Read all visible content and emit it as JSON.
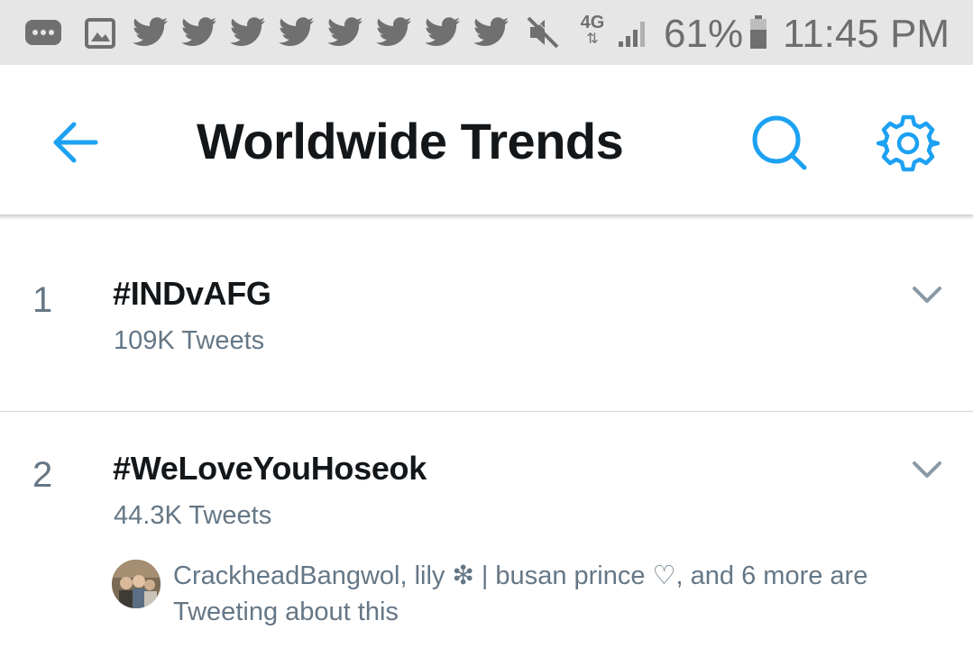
{
  "status_bar": {
    "network": "4G",
    "battery": "61%",
    "time": "11:45 PM",
    "icons": [
      "messages-icon",
      "gallery-icon",
      "twitter-icon",
      "twitter-icon",
      "twitter-icon",
      "twitter-icon",
      "twitter-icon",
      "twitter-icon",
      "twitter-icon",
      "twitter-icon",
      "mute-icon",
      "network-4g-icon",
      "signal-icon",
      "battery-icon"
    ]
  },
  "toolbar": {
    "title": "Worldwide Trends",
    "back_icon": "arrow-left-icon",
    "search_icon": "search-icon",
    "settings_icon": "gear-icon"
  },
  "trends": [
    {
      "rank": "1",
      "name": "#INDvAFG",
      "count": "109K Tweets"
    },
    {
      "rank": "2",
      "name": "#WeLoveYouHoseok",
      "count": "44.3K Tweets",
      "context": "CrackheadBangwol, lily ❇ | busan prince ♡, and 6 more are Tweeting about this"
    }
  ],
  "colors": {
    "accent": "#1da1f2",
    "text_primary": "#14171a",
    "text_secondary": "#657786",
    "status_bar_bg": "#e6e6e6"
  }
}
